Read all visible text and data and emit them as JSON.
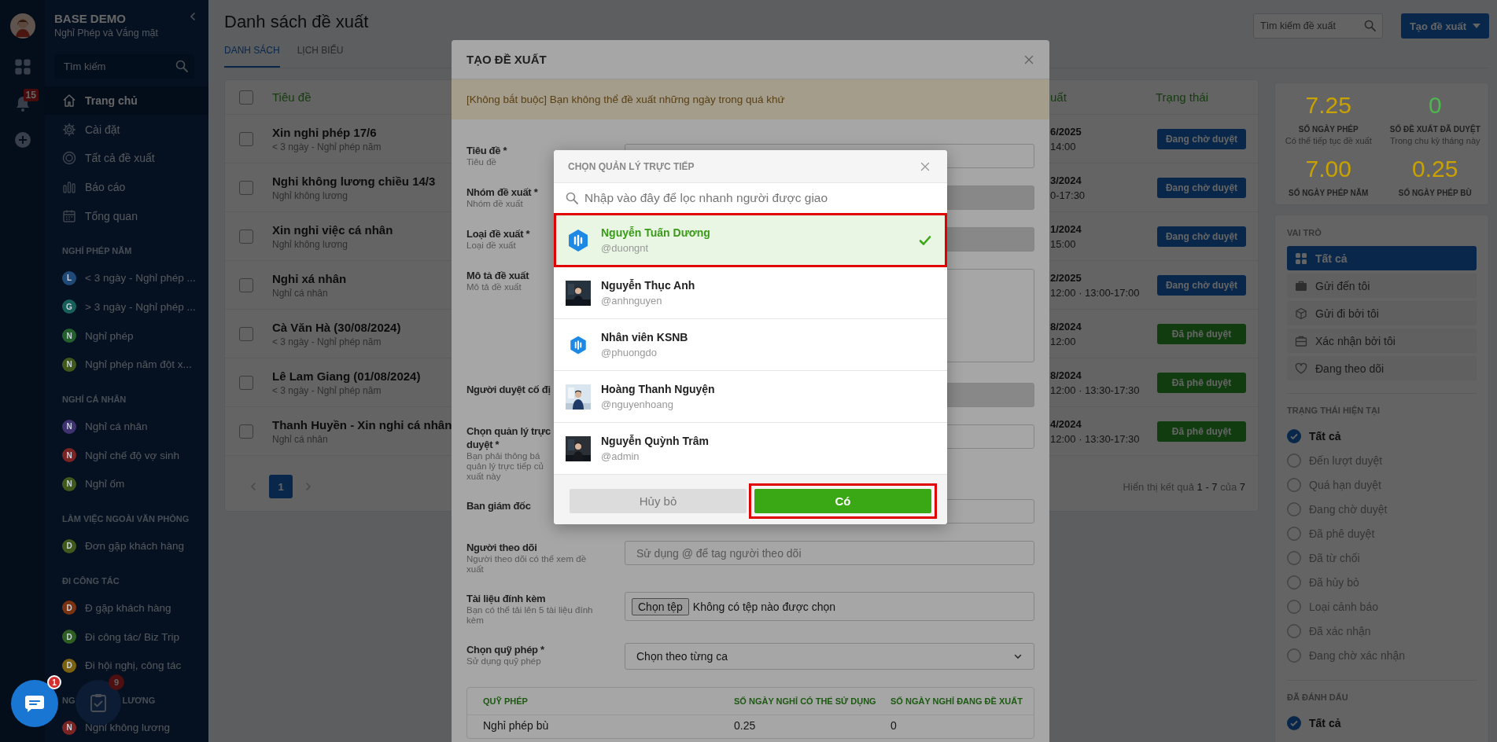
{
  "sidebar": {
    "company": "BASE DEMO",
    "subtitle": "Nghỉ Phép và Vắng mặt",
    "search_placeholder": "Tìm kiếm",
    "notification_count": "15",
    "nav": [
      {
        "label": "Trang chủ",
        "selected": true
      },
      {
        "label": "Cài đặt",
        "selected": false
      },
      {
        "label": "Tất cả đề xuất",
        "selected": false
      },
      {
        "label": "Báo cáo",
        "selected": false
      },
      {
        "label": "Tổng quan",
        "selected": false
      }
    ],
    "groups": [
      {
        "title_parts": [
          "NGHỈ PHÉP NĂM"
        ],
        "items": [
          {
            "letter": "L",
            "label": "< 3 ngày - Nghỉ phép ...",
            "color": "#1f4a78"
          },
          {
            "letter": "G",
            "label": "> 3 ngày - Nghỉ phép ...",
            "color": "#17605a"
          },
          {
            "letter": "N",
            "label": "Nghỉ phép",
            "color": "#24602e"
          },
          {
            "letter": "N",
            "label": "Nghỉ phép năm đột x...",
            "color": "#3f5a1c"
          }
        ]
      },
      {
        "title_parts": [
          "NGHỈ CÁ NHÂN"
        ],
        "items": [
          {
            "letter": "N",
            "label": "Nghỉ cá nhân",
            "color": "#3f3270"
          },
          {
            "letter": "N",
            "label": "Nghỉ chế độ vợ sinh",
            "color": "#7a2424"
          },
          {
            "letter": "N",
            "label": "Nghỉ ốm",
            "color": "#3f5a1c"
          }
        ]
      },
      {
        "title_parts": [
          "LÀM VIỆC NGOÀI VĂN PHÒNG"
        ],
        "items": [
          {
            "letter": "D",
            "label": "Đơn gặp khách hàng",
            "color": "#3f5a1c"
          }
        ]
      },
      {
        "title_parts": [
          "ĐI CÔNG TÁC"
        ],
        "items": [
          {
            "letter": "D",
            "label": "Đ gặp khách hàng",
            "color": "#7a3312"
          },
          {
            "letter": "D",
            "label": "Đi công tác/ Biz Trip",
            "color": "#2f5e22"
          },
          {
            "letter": "D",
            "label": "Đi hội nghị, công tác",
            "color": "#7a6210"
          }
        ]
      },
      {
        "title_parts": [
          "NG",
          "LƯƠNG"
        ],
        "items": [
          {
            "letter": "N",
            "label": "Nghỉ không lương",
            "color": "#7a2424"
          }
        ]
      }
    ]
  },
  "list": {
    "title": "Danh sách đề xuất",
    "tabs": [
      {
        "label": "DANH SÁCH",
        "selected": true
      },
      {
        "label": "LỊCH BIỂU",
        "selected": false
      }
    ],
    "search_placeholder": "Tìm kiếm đề xuất",
    "create_button": "Tạo đề xuất",
    "table": {
      "all_checked": false,
      "columns": [
        "Tiêu đề",
        "uất",
        "Trạng thái"
      ],
      "rows": [
        {
          "checked": false,
          "title": "Xin nghỉ phép 17/6",
          "subtitle": "< 3 ngày - Nghỉ phép năm",
          "date": "6/2025",
          "time": "14:00",
          "status": {
            "label": "Đang chờ duyệt",
            "kind": "pending"
          }
        },
        {
          "checked": false,
          "title": "Nghỉ không lương chiều 14/3",
          "subtitle": "Nghỉ không lương",
          "date": "3/2024",
          "time": "0-17:30",
          "status": {
            "label": "Đang chờ duyệt",
            "kind": "pending"
          }
        },
        {
          "checked": false,
          "title": "Xin nghỉ việc cá nhân",
          "subtitle": "Nghỉ không lương",
          "date": "1/2024",
          "time": "15:00",
          "status": {
            "label": "Đang chờ duyệt",
            "kind": "pending"
          }
        },
        {
          "checked": false,
          "title": "Nghỉ xá nhân",
          "subtitle": "Nghỉ cá nhân",
          "date": "2/2025",
          "time": "12:00 · 13:00-17:00",
          "status": {
            "label": "Đang chờ duyệt",
            "kind": "pending"
          }
        },
        {
          "checked": false,
          "title": "Cà Văn Hà (30/08/2024)",
          "subtitle": "< 3 ngày - Nghỉ phép năm",
          "date": "8/2024",
          "time": "12:00",
          "status": {
            "label": "Đã phê duyệt",
            "kind": "approved"
          }
        },
        {
          "checked": false,
          "title": "Lê Lam Giang (01/08/2024)",
          "subtitle": "< 3 ngày - Nghỉ phép năm",
          "date": "8/2024",
          "time": "12:00 · 13:30-17:30",
          "status": {
            "label": "Đã phê duyệt",
            "kind": "approved"
          }
        },
        {
          "checked": false,
          "title": "Thanh Huyền - Xin nghỉ cá nhân",
          "subtitle": "Nghỉ cá nhân",
          "date": "4/2024",
          "time": "12:00 · 13:30-17:30",
          "status": {
            "label": "Đã phê duyệt",
            "kind": "approved"
          }
        }
      ]
    },
    "pagination": {
      "pages": [
        {
          "label": "1",
          "selected": true
        }
      ],
      "summary": "Hiển thị kết quả **1 - 7** của **7**"
    }
  },
  "panel": {
    "stats": [
      {
        "value": "7.25",
        "label": "SỐ NGÀY PHÉP",
        "note": "Có thể tiếp tục đề xuất",
        "color": "#c9a200"
      },
      {
        "value": "0",
        "label": "SỐ ĐỀ XUẤT ĐÃ DUYỆT",
        "note": "Trong chu kỳ tháng này",
        "color": "#4cb84c"
      },
      {
        "value": "7.00",
        "label": "SỐ NGÀY PHÉP NĂM",
        "color": "#c9a200"
      },
      {
        "value": "0.25",
        "label": "SỐ NGÀY PHÉP BÙ",
        "color": "#c9a200"
      }
    ],
    "roles": {
      "title": "VAI TRÒ",
      "items": [
        {
          "label": "Tất cả",
          "selected": true
        },
        {
          "label": "Gửi đến tôi",
          "selected": false
        },
        {
          "label": "Gửi đi bởi tôi",
          "selected": false
        },
        {
          "label": "Xác nhận bởi tôi",
          "selected": false
        },
        {
          "label": "Đang theo dõi",
          "selected": false
        }
      ]
    },
    "status_filter": {
      "title": "TRẠNG THÁI HIỆN TẠI",
      "options": [
        {
          "label": "Tất cả",
          "selected": true
        },
        {
          "label": "Đến lượt duyệt",
          "selected": false
        },
        {
          "label": "Quá hạn duyệt",
          "selected": false
        },
        {
          "label": "Đang chờ duyệt",
          "selected": false
        },
        {
          "label": "Đã phê duyệt",
          "selected": false
        },
        {
          "label": "Đã từ chối",
          "selected": false
        },
        {
          "label": "Đã hủy bỏ",
          "selected": false
        },
        {
          "label": "Loại cảnh báo",
          "selected": false
        },
        {
          "label": "Đã xác nhận",
          "selected": false
        },
        {
          "label": "Đang chờ xác nhận",
          "selected": false
        }
      ]
    },
    "marked": {
      "title": "ĐÃ ĐÁNH DẤU",
      "options": [
        {
          "label": "Tất cả",
          "selected": true
        }
      ]
    }
  },
  "modal": {
    "title": "TẠO ĐỀ XUẤT",
    "notice": "[Không bắt buộc] Bạn không thể đề xuất những ngày trong quá khứ",
    "fields": [
      {
        "kind": "input",
        "disabled": false,
        "label_lines": [
          "Tiêu đề *"
        ],
        "hint_lines": [
          "Tiêu đề"
        ]
      },
      {
        "kind": "input",
        "disabled": true,
        "label_lines": [
          "Nhóm đề xuất *"
        ],
        "hint_lines": [
          "Nhóm đề xuất"
        ]
      },
      {
        "kind": "input",
        "disabled": true,
        "label_lines": [
          "Loại đề xuất *"
        ],
        "hint_lines": [
          "Loại đề xuất"
        ]
      },
      {
        "kind": "textarea",
        "label_lines": [
          "Mô tả đề xuất"
        ],
        "hint_lines": [
          "Mô tả đề xuất"
        ]
      },
      {
        "kind": "input",
        "disabled": true,
        "label_lines": [
          "Người duyệt cố đị"
        ]
      },
      {
        "kind": "input",
        "disabled": false,
        "label_lines": [
          "Chọn quản lý trực",
          "duyệt *"
        ],
        "hint_lines": [
          "Bạn phải thông bá",
          "quản lý trực tiếp củ",
          "xuất này"
        ]
      },
      {
        "kind": "input",
        "disabled": false,
        "label_lines": [
          "Ban giám đốc"
        ]
      },
      {
        "kind": "input",
        "disabled": false,
        "label_lines": [
          "Người theo dõi"
        ],
        "hint_lines": [
          "Người theo dõi có thể xem đề",
          "xuất"
        ],
        "placeholder": "Sử dụng @ để tag người theo dõi"
      },
      {
        "kind": "file",
        "label_lines": [
          "Tài liệu đính kèm"
        ],
        "hint_lines": [
          "Bạn có thể tải lên 5 tài liệu đính",
          "kèm"
        ],
        "button": "Chọn tệp",
        "value": "Không có tệp nào được chọn"
      },
      {
        "kind": "select",
        "label_lines": [
          "Chọn quỹ phép *"
        ],
        "hint_lines": [
          "Sử dụng quỹ phép"
        ],
        "value": "Chọn theo từng ca"
      }
    ],
    "quota": {
      "columns": [
        "QUỸ PHÉP",
        "SỐ NGÀY NGHỈ CÓ THỂ SỬ DỤNG",
        "SỐ NGÀY NGHỈ ĐANG ĐỀ XUẤT"
      ],
      "rows": [
        [
          "Nghỉ phép bù",
          "0.25",
          "0"
        ]
      ]
    }
  },
  "picker": {
    "title": "CHỌN QUẢN LÝ TRỰC TIẾP",
    "search_placeholder": "Nhập vào đây để lọc nhanh người được giao",
    "people": [
      {
        "name": "Nguyễn Tuấn Dương",
        "username": "@duongnt",
        "kind": "logo",
        "selected": true,
        "highlighted": true
      },
      {
        "name": "Nguyễn Thục Anh",
        "username": "@anhnguyen",
        "kind": "picture",
        "selected": false,
        "highlighted": false
      },
      {
        "name": "Nhân viên KSNB",
        "username": "@phuongdo",
        "kind": "logo",
        "selected": false,
        "highlighted": false
      },
      {
        "name": "Hoàng Thanh Nguyện",
        "username": "@nguyenhoang",
        "kind": "picture",
        "selected": false,
        "highlighted": false
      },
      {
        "name": "Nguyễn Quỳnh Trâm",
        "username": "@admin",
        "kind": "picture",
        "selected": false,
        "highlighted": false
      }
    ],
    "cancel": "Hủy bỏ",
    "confirm": {
      "label": "Có",
      "highlighted": true
    }
  },
  "floating": {
    "chat_badge": "1",
    "tasks_badge": "9"
  }
}
